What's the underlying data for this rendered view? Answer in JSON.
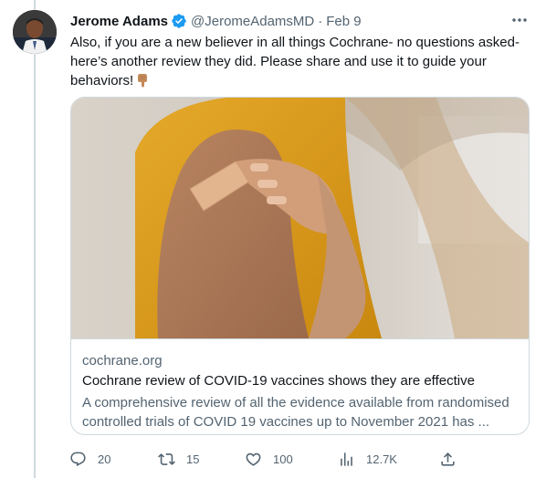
{
  "tweet": {
    "author_name": "Jerome Adams",
    "author_handle": "@JeromeAdamsMD",
    "separator": "·",
    "date": "Feb 9",
    "text_lines": [
      "Also, if you are a new believer in all things Cochrane- no questions asked-",
      "here’s another review they did. Please share and use it to guide your",
      "behaviors!"
    ]
  },
  "card": {
    "domain": "cochrane.org",
    "title": "Cochrane review of COVID-19 vaccines shows they are effective",
    "description_lines": [
      "A comprehensive review of all the evidence available from randomised",
      "controlled trials of COVID 19 vaccines up to November 2021 has ..."
    ]
  },
  "actions": {
    "replies": "20",
    "retweets": "15",
    "likes": "100",
    "views": "12.7K"
  },
  "colors": {
    "accent": "#1d9bf0",
    "secondary_text": "#536471",
    "border": "#cfd9de"
  },
  "icons": [
    "verified-badge-icon",
    "more-options-icon",
    "pointing-down-emoji-icon",
    "reply-icon",
    "retweet-icon",
    "like-icon",
    "views-icon",
    "share-icon"
  ]
}
